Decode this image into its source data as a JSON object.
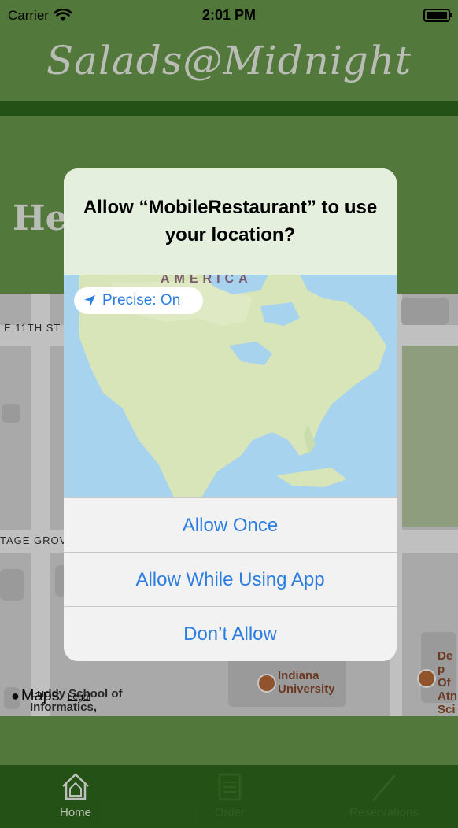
{
  "status_bar": {
    "carrier": "Carrier",
    "time": "2:01 PM"
  },
  "header": {
    "title": "Salads@Midnight"
  },
  "content": {
    "greeting_partial": "Hel"
  },
  "map": {
    "street_labels": [
      "E 11TH ST",
      "TAGE GROV"
    ],
    "pois": [
      "Indiana University",
      "Luddy School of Informatics,",
      "Dep Of Atn Sci"
    ],
    "attribution": "Maps",
    "legal": "Legal"
  },
  "alert": {
    "title": "Allow “MobileRestaurant” to use your location?",
    "precise_label": "Precise: On",
    "map_label": "AMERICA",
    "buttons": {
      "allow_once": "Allow Once",
      "allow_while_using": "Allow While Using App",
      "dont_allow": "Don’t Allow"
    }
  },
  "tab_bar": {
    "tabs": [
      {
        "label": "Home",
        "icon": "home-icon",
        "active": true
      },
      {
        "label": "Order",
        "icon": "clipboard-icon",
        "active": false
      },
      {
        "label": "Reservations",
        "icon": "pencil-icon",
        "active": false
      }
    ]
  },
  "colors": {
    "accent_blue": "#2a7de1",
    "header_green": "#6a9a4c",
    "tab_green": "#2f6a1d"
  }
}
